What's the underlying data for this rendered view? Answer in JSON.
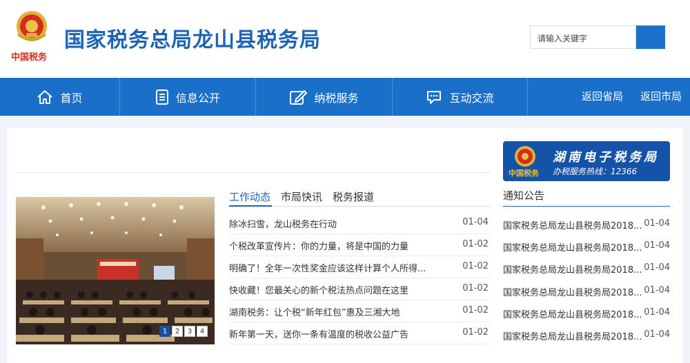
{
  "header": {
    "site_title": "国家税务总局龙山县税务局",
    "logo_text": "中国税务",
    "search_placeholder": "请输入关键字"
  },
  "nav": {
    "items": [
      {
        "label": "首页",
        "icon": "home-icon"
      },
      {
        "label": "信息公开",
        "icon": "document-icon"
      },
      {
        "label": "纳税服务",
        "icon": "edit-icon"
      },
      {
        "label": "互动交流",
        "icon": "chat-icon"
      }
    ],
    "links": [
      "返回省局",
      "返回市局"
    ]
  },
  "news": {
    "tabs": [
      "工作动态",
      "市局快讯",
      "税务报道"
    ],
    "active_tab": "工作动态",
    "items": [
      {
        "title": "除冰扫雪，龙山税务在行动",
        "date": "01-04"
      },
      {
        "title": "个税改革宣传片：你的力量，将是中国的力量",
        "date": "01-02"
      },
      {
        "title": "明确了！全年一次性奖金应该这样计算个人所得...",
        "date": "01-02"
      },
      {
        "title": "快收藏！您最关心的新个税法热点问题在这里",
        "date": "01-02"
      },
      {
        "title": "湖南税务：让个税“新年红包”惠及三湘大地",
        "date": "01-02"
      },
      {
        "title": "新年第一天，送你一条有温度的税收公益广告",
        "date": "01-02"
      }
    ]
  },
  "carousel": {
    "pages": [
      "1",
      "2",
      "3",
      "4"
    ],
    "active_page": "1"
  },
  "banner": {
    "title": "湖南电子税务局",
    "hotline": "办税服务热线：12366",
    "logo_text": "中国税务"
  },
  "notices": {
    "title": "通知公告",
    "items": [
      {
        "title": "国家税务总局龙山县税务局2018...",
        "date": "01-04"
      },
      {
        "title": "国家税务总局龙山县税务局2018...",
        "date": "01-04"
      },
      {
        "title": "国家税务总局龙山县税务局2018...",
        "date": "01-04"
      },
      {
        "title": "国家税务总局龙山县税务局2018...",
        "date": "01-04"
      },
      {
        "title": "国家税务总局龙山县税务局2018...",
        "date": "01-04"
      },
      {
        "title": "国家税务总局龙山县税务局2018...",
        "date": "01-04"
      }
    ]
  },
  "colors": {
    "primary": "#1a6fc9",
    "title_blue": "#1d63b6",
    "banner_blue": "#1553a8"
  }
}
